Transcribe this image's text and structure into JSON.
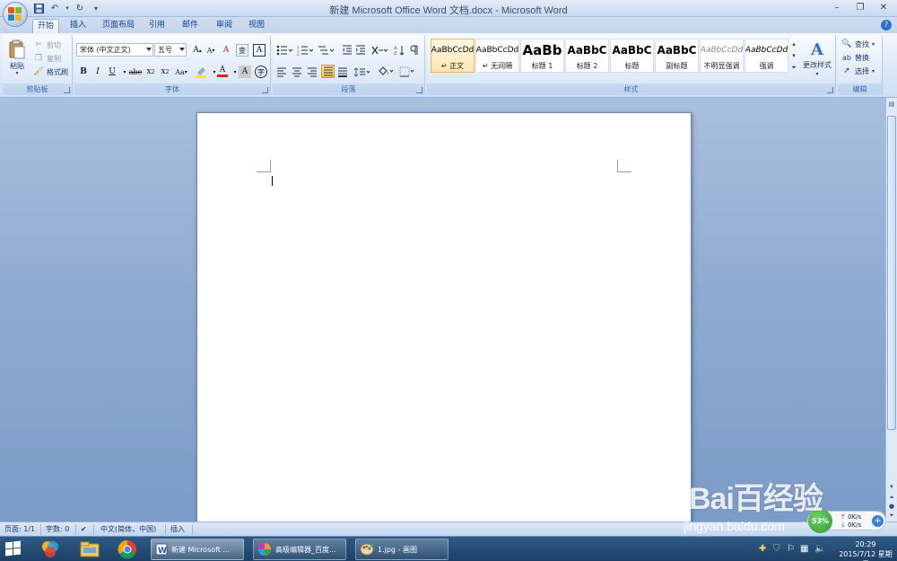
{
  "window": {
    "title": "新建 Microsoft Office Word 文档.docx - Microsoft Word",
    "controls": {
      "minimize": "–",
      "restore": "❐",
      "close": "✕"
    }
  },
  "quick_access": {
    "customize": "▾"
  },
  "tabs": [
    {
      "label": "开始",
      "active": true
    },
    {
      "label": "插入"
    },
    {
      "label": "页面布局"
    },
    {
      "label": "引用"
    },
    {
      "label": "邮件"
    },
    {
      "label": "审阅"
    },
    {
      "label": "视图"
    }
  ],
  "clipboard": {
    "label": "剪贴板",
    "paste": "粘贴",
    "cut": "剪切",
    "copy": "复制",
    "format_painter": "格式刷"
  },
  "font": {
    "label": "字体",
    "font_name": "宋体 (中文正文)",
    "font_size": "五号",
    "grow": "A",
    "shrink": "A",
    "clear": "A",
    "phonetic": "变",
    "border_char": "A",
    "bold": "B",
    "italic": "I",
    "underline": "U",
    "strike": "abe",
    "subscript": "x",
    "superscript": "x",
    "case": "Aa",
    "highlight": "ab",
    "color": "A",
    "shade": "A",
    "enclose": "字"
  },
  "paragraph": {
    "label": "段落"
  },
  "styles": {
    "label": "样式",
    "items": [
      {
        "sample": "AaBbCcDd",
        "name": "↵ 正文",
        "selected": true
      },
      {
        "sample": "AaBbCcDd",
        "name": "↵ 无间隔"
      },
      {
        "sample": "AaBb",
        "name": "标题 1"
      },
      {
        "sample": "AaBbC",
        "name": "标题 2"
      },
      {
        "sample": "AaBbC",
        "name": "标题"
      },
      {
        "sample": "AaBbC",
        "name": "副标题"
      },
      {
        "sample": "AaBbCcDd",
        "name": "不明显强调"
      },
      {
        "sample": "AaBbCcDd",
        "name": "强调"
      }
    ],
    "change_styles": "更改样式"
  },
  "editing": {
    "label": "编辑",
    "find": "查找",
    "replace": "替换",
    "select": "选择"
  },
  "status": {
    "page": "页面: 1/1",
    "words": "字数: 0",
    "language": "中文(简体，中国)",
    "mode": "插入"
  },
  "taskbar": {
    "tasks": [
      {
        "label": "新建 Microsoft ..."
      },
      {
        "label": "高级编辑器_百度..."
      },
      {
        "label": "1.jpg - 画图"
      }
    ],
    "time": "20:29",
    "date": "2015/7/12 星期日"
  },
  "net_widget": {
    "percent": "53%",
    "up": "0K/s",
    "down": "0K/s"
  },
  "watermark": {
    "main": "Bai百经验",
    "sub": "jingyan.baidu.com"
  },
  "colors": {
    "ribbon_text": "#15428b",
    "doc_bg": "#8eabd1",
    "taskbar": "#1d4066",
    "highlight_yellow": "#ffe600",
    "font_red": "#e02020"
  }
}
